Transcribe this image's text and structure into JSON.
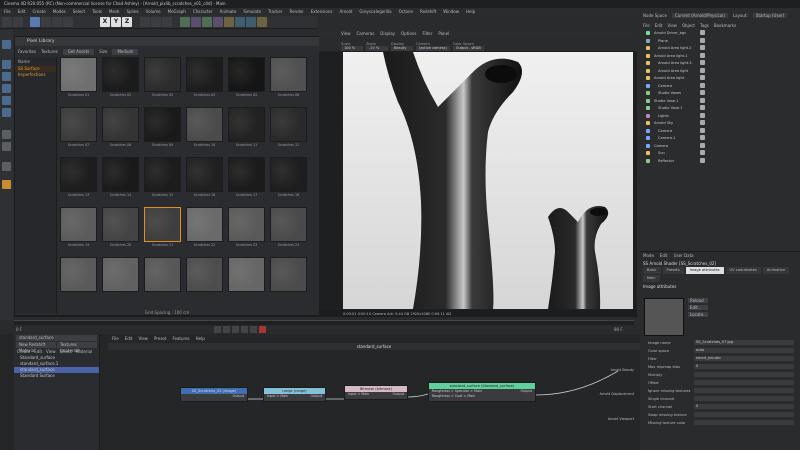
{
  "window_title": "Cinema 4D R20.055 (RC) (Non-commercial license for Chad Ashley) - [Arnold_pixlib_scratches_v01_c4d] - Main",
  "menu": [
    "File",
    "Edit",
    "Create",
    "Modes",
    "Select",
    "Tools",
    "Mesh",
    "Spline",
    "Volume",
    "MoGraph",
    "Character",
    "Animate",
    "Simulate",
    "Tracker",
    "Render",
    "Extensions",
    "Arnold",
    "Greyscalegorilla",
    "Octane",
    "Redshift",
    "Window",
    "Help"
  ],
  "toolbar": {
    "xyz": [
      "X",
      "Y",
      "Z"
    ]
  },
  "pixlib": {
    "title": "Pixel Library",
    "bar": {
      "favorites": "Favorites",
      "textures": "Textures",
      "get_assets": "Get Assets",
      "size_label": "Size",
      "size_value": "Medium"
    },
    "tree": {
      "header": "Name",
      "selected": "SS Surface Imperfections"
    },
    "thumbs": [
      {
        "name": "Scratches 01",
        "tone": "#6f6f6f"
      },
      {
        "name": "Scratches 02",
        "tone": "#1b1b1b"
      },
      {
        "name": "Scratches 03",
        "tone": "#2c2c2c"
      },
      {
        "name": "Scratches 04",
        "tone": "#1d1d1d"
      },
      {
        "name": "Scratches 05",
        "tone": "#151515"
      },
      {
        "name": "Scratches 06",
        "tone": "#505050"
      },
      {
        "name": "Scratches 07",
        "tone": "#3b3b3b"
      },
      {
        "name": "Scratches 08",
        "tone": "#343434"
      },
      {
        "name": "Scratches 09",
        "tone": "#1a1a1a"
      },
      {
        "name": "Scratches 10",
        "tone": "#4b4b4b"
      },
      {
        "name": "Scratches 11",
        "tone": "#222222"
      },
      {
        "name": "Scratches 12",
        "tone": "#2a2a2a"
      },
      {
        "name": "Scratches 13",
        "tone": "#1d1d1d"
      },
      {
        "name": "Scratches 14",
        "tone": "#1a1a1a"
      },
      {
        "name": "Scratches 15",
        "tone": "#1c1c1c"
      },
      {
        "name": "Scratches 16",
        "tone": "#202020"
      },
      {
        "name": "Scratches 17",
        "tone": "#1b1b1b"
      },
      {
        "name": "Scratches 18",
        "tone": "#1e1e1e"
      },
      {
        "name": "Scratches 19",
        "tone": "#5c5c5c"
      },
      {
        "name": "Scratches 20",
        "tone": "#444444"
      },
      {
        "name": "Scratches 21",
        "tone": "#3e3e3e"
      },
      {
        "name": "Scratches 22",
        "tone": "#6a6a6a"
      },
      {
        "name": "Scratches 23",
        "tone": "#5a5a5a"
      },
      {
        "name": "Scratches 24",
        "tone": "#4a4a4a"
      },
      {
        "name": "",
        "tone": "#5a5a5a"
      },
      {
        "name": "",
        "tone": "#616161"
      },
      {
        "name": "",
        "tone": "#575757"
      },
      {
        "name": "",
        "tone": "#4d4d4d"
      },
      {
        "name": "",
        "tone": "#666666"
      },
      {
        "name": "",
        "tone": "#4b4b4b"
      }
    ],
    "selected_index": 20,
    "status": "Grid Spacing : 100 cm"
  },
  "viewport": {
    "menu": [
      "View",
      "Cameras",
      "Display",
      "Options",
      "Filter",
      "Panel"
    ],
    "tab": "IPR",
    "menu2": [
      "View",
      "Render"
    ],
    "fields": [
      {
        "label": "Scale",
        "value": "100 %"
      },
      {
        "label": "Zoom",
        "value": "-10 %"
      },
      {
        "label": "Display",
        "value": "Beauty"
      },
      {
        "label": "Camera",
        "value": "(active camera)"
      },
      {
        "label": "Color Space",
        "value": "Output - sRGB"
      }
    ],
    "status": "0:00:01 0:00:10  Camera Ark: 9.44 GB  1920x1080  0:00:11  AD",
    "grid_status": "Grid Spacing : 100 cm"
  },
  "timeline": {
    "frame": "0 F",
    "end": "90 F"
  },
  "right": {
    "node_space": "Node Space",
    "node_space_value": "Current (Arnold/Physical)",
    "layout": "Layout:",
    "layout_value": "Startup (User)",
    "tabs": [
      "File",
      "Edit",
      "View",
      "Object",
      "Tags",
      "Bookmarks"
    ],
    "objects": [
      "Arnold Driver_bgc",
      "Plane",
      "Arnold Area light.2",
      "Arnold Area light.1",
      "Arnold Area light.3",
      "Arnold Area light",
      "Arnold Area light",
      "Camera",
      "Studio Vases",
      "Studio Vase.1",
      "Studio Vase.1",
      "Lights",
      "Arnold Sky",
      "Camera",
      "Camera.1",
      "Camera",
      "Sun",
      "Reflector"
    ],
    "attr_menu": [
      "Mode",
      "Edit",
      "User Data"
    ],
    "attr_title": "SS Arnold Shader [SS_Scratches_02]",
    "attr_tabs": [
      "Basic",
      "Presets",
      "Image attributes",
      "UV coordinates",
      "Animation"
    ],
    "attr_tab2": "Main",
    "image_attr": "Image attributes",
    "preview_buttons": [
      "Reload",
      "Edit...",
      "Locate..."
    ],
    "rows": [
      {
        "label": "Image name",
        "value": "SS_Scratches_07.jpg"
      },
      {
        "label": "Color space",
        "value": "auto"
      },
      {
        "label": "Filter",
        "value": "smart_bicubic"
      },
      {
        "label": "Max mipmap bias",
        "value": "0"
      },
      {
        "label": "Multiply",
        "value": ""
      },
      {
        "label": "Offset",
        "value": ""
      },
      {
        "label": "Ignore missing textures",
        "value": ""
      },
      {
        "label": "Single channel",
        "value": ""
      },
      {
        "label": "Start channel",
        "value": "0"
      },
      {
        "label": "Swap missing texture",
        "value": ""
      },
      {
        "label": "Missing texture color",
        "value": ""
      }
    ]
  },
  "materials": {
    "buttons": [
      "standard_surface",
      "New Redshift Material",
      "Textures (material)"
    ],
    "menu": [
      "Create",
      "Edit",
      "View",
      "Select",
      "Material"
    ],
    "items": [
      "Standard_surface",
      "standard_surface.1",
      "standard_surface",
      "Standard Surface"
    ]
  },
  "nodes": {
    "menu": [
      "File",
      "Edit",
      "View",
      "Preset",
      "Features",
      "Help"
    ],
    "title": "standard_surface",
    "n1": {
      "title": "SS_Scratches_02 (image)",
      "out": "Output"
    },
    "n2": {
      "title": "range (range)",
      "in": "Input > Main",
      "out": "Output"
    },
    "n3": {
      "title": "Bitmask (bitmask)",
      "in": "Input > Main",
      "out": "Output"
    },
    "n4": {
      "title": "standard_surface (Standard_surface)",
      "in1": "Roughness > Specular > Main",
      "in2": "Roughness > Coat > Main",
      "out": "Output"
    },
    "ports": [
      "Arnold Beauty",
      "Arnold Displacement",
      "Arnold Viewport"
    ]
  },
  "colors": {
    "accent": "#e38c2a",
    "selected": "#4a62a6"
  }
}
